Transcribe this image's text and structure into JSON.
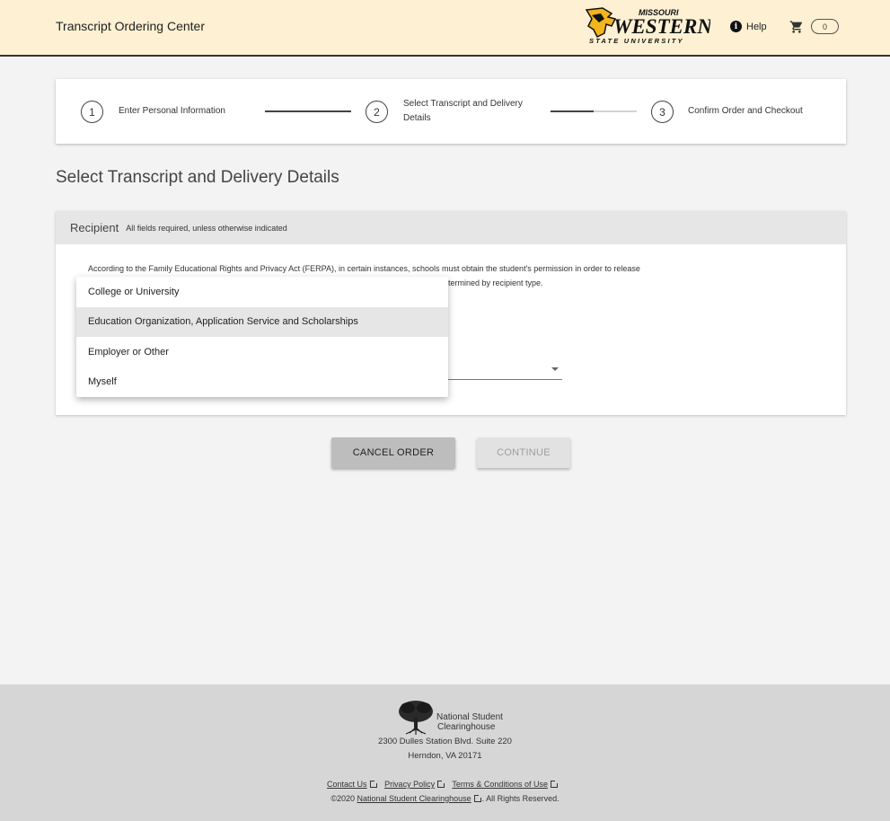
{
  "header": {
    "title": "Transcript Ordering Center",
    "logo": {
      "top": "MISSOURI",
      "main": "WESTERN",
      "sub": "STATE UNIVERSITY"
    },
    "help_label": "Help",
    "cart_count": "0"
  },
  "stepper": {
    "steps": [
      {
        "number": "1",
        "label": "Enter Personal Information"
      },
      {
        "number": "2",
        "label": "Select Transcript and Delivery Details"
      },
      {
        "number": "3",
        "label": "Confirm Order and Checkout"
      }
    ],
    "progress": [
      1.0,
      0.5
    ]
  },
  "page_title": "Select Transcript and Delivery Details",
  "recipient": {
    "title": "Recipient",
    "note": "All fields required, unless otherwise indicated",
    "ferpa_line1": "According to the Family Educational Rights and Privacy Act (FERPA), in certain instances, schools must obtain the student's permission in order to release",
    "ferpa_line2_visible": "etermined by recipient type."
  },
  "dropdown": {
    "options": [
      "College or University",
      "Education Organization, Application Service and Scholarships",
      "Employer or Other",
      "Myself"
    ],
    "highlighted_index": 1
  },
  "buttons": {
    "cancel": "CANCEL ORDER",
    "continue": "CONTINUE"
  },
  "footer": {
    "org_name_line1": "National Student",
    "org_name_line2": "Clearinghouse",
    "address_line1": "2300 Dulles Station Blvd. Suite 220",
    "address_line2": "Herndon, VA 20171",
    "links": [
      "Contact Us",
      "Privacy Policy",
      "Terms & Conditions of Use"
    ],
    "copyright_prefix": "©2020",
    "copyright_link": "National Student Clearinghouse",
    "copyright_suffix": ". All Rights Reserved."
  },
  "colors": {
    "header_bg": "#fdf0d3",
    "logo_gold": "#f2b51c",
    "page_bg": "#f3f3f3",
    "footer_bg": "#d6d6d6"
  }
}
